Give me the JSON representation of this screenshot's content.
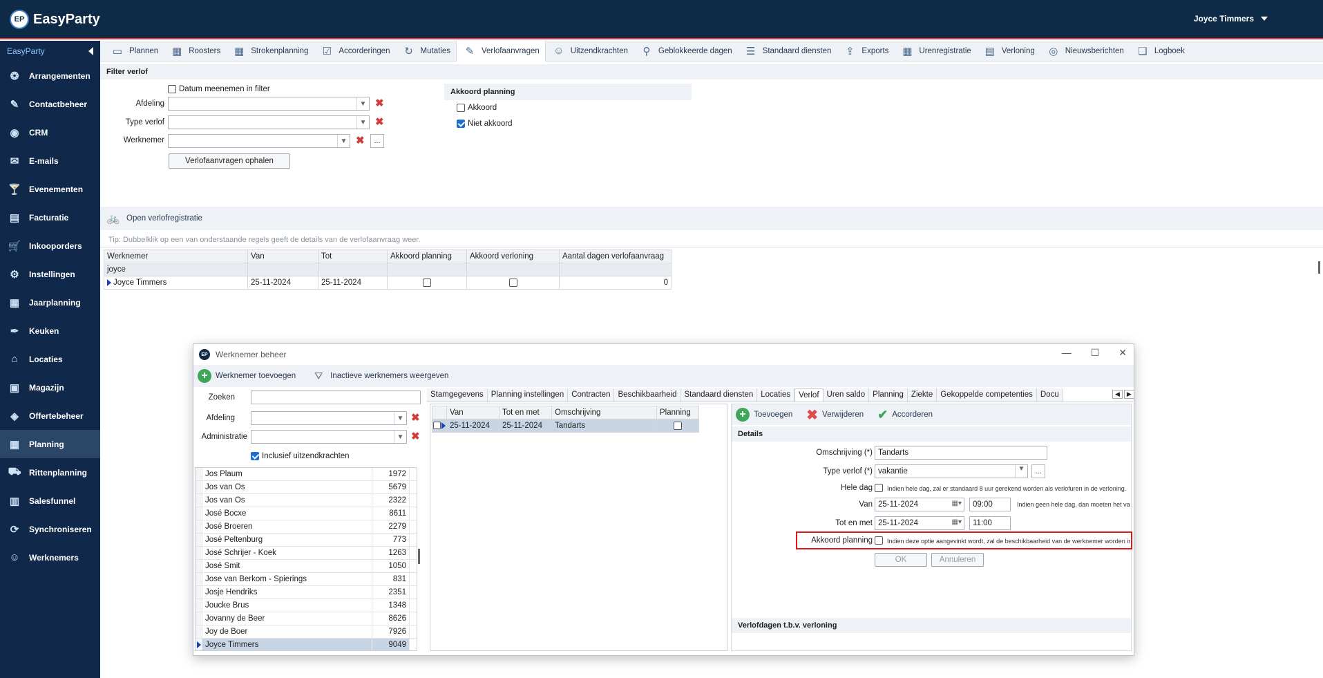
{
  "app": {
    "name": "EasyParty",
    "logo_badge": "EP",
    "user": "Joyce Timmers"
  },
  "sidebar": {
    "header": "EasyParty",
    "items": [
      {
        "label": "Arrangementen",
        "icon": "balloons-icon"
      },
      {
        "label": "Contactbeheer",
        "icon": "contact-edit-icon"
      },
      {
        "label": "CRM",
        "icon": "crm-icon"
      },
      {
        "label": "E-mails",
        "icon": "envelope-icon"
      },
      {
        "label": "Evenementen",
        "icon": "cocktail-icon"
      },
      {
        "label": "Facturatie",
        "icon": "invoice-icon"
      },
      {
        "label": "Inkooporders",
        "icon": "cart-icon"
      },
      {
        "label": "Instellingen",
        "icon": "gear-icon"
      },
      {
        "label": "Jaarplanning",
        "icon": "calendar-icon"
      },
      {
        "label": "Keuken",
        "icon": "knife-icon"
      },
      {
        "label": "Locaties",
        "icon": "house-icon"
      },
      {
        "label": "Magazijn",
        "icon": "box-icon"
      },
      {
        "label": "Offertebeheer",
        "icon": "quote-icon"
      },
      {
        "label": "Planning",
        "icon": "planning-icon"
      },
      {
        "label": "Rittenplanning",
        "icon": "truck-icon"
      },
      {
        "label": "Salesfunnel",
        "icon": "funnel-icon"
      },
      {
        "label": "Synchroniseren",
        "icon": "sync-icon"
      },
      {
        "label": "Werknemers",
        "icon": "employee-icon"
      }
    ],
    "active": "Planning"
  },
  "toolbar": {
    "items": [
      {
        "label": "Plannen",
        "icon": "plan-icon"
      },
      {
        "label": "Roosters",
        "icon": "calendar-icon"
      },
      {
        "label": "Strokenplanning",
        "icon": "calendar-icon"
      },
      {
        "label": "Accorderingen",
        "icon": "approve-icon"
      },
      {
        "label": "Mutaties",
        "icon": "refresh-icon"
      },
      {
        "label": "Verlofaanvragen",
        "icon": "edit-icon"
      },
      {
        "label": "Uitzendkrachten",
        "icon": "people-icon"
      },
      {
        "label": "Geblokkeerde dagen",
        "icon": "search-icon"
      },
      {
        "label": "Standaard diensten",
        "icon": "list-icon"
      },
      {
        "label": "Exports",
        "icon": "upload-icon"
      },
      {
        "label": "Urenregistratie",
        "icon": "calendar-icon"
      },
      {
        "label": "Verloning",
        "icon": "document-check-icon"
      },
      {
        "label": "Nieuwsberichten",
        "icon": "glasses-icon"
      },
      {
        "label": "Logboek",
        "icon": "log-icon"
      }
    ],
    "active": "Verlofaanvragen"
  },
  "filter": {
    "header": "Filter verlof",
    "datum_label": "Datum meenemen in filter",
    "afdeling_label": "Afdeling",
    "type_label": "Type verlof",
    "werknemer_label": "Werknemer",
    "ellipsis": "...",
    "fetch_button": "Verlofaanvragen ophalen",
    "akkoord_header": "Akkoord planning",
    "akkoord_label": "Akkoord",
    "niet_akkoord_label": "Niet akkoord"
  },
  "open_registratie": {
    "title": "Open verlofregistratie",
    "tip": "Tip: Dubbelklik op een van onderstaande regels geeft de details van de verlofaanvraag weer.",
    "columns": [
      "Werknemer",
      "Van",
      "Tot",
      "Akkoord planning",
      "Akkoord verloning",
      "Aantal dagen verlofaanvraag"
    ],
    "filter_value": "joyce",
    "rows": [
      {
        "werknemer": "Joyce Timmers",
        "van": "25-11-2024",
        "tot": "25-11-2024",
        "akkoord_planning": false,
        "akkoord_verloning": false,
        "aantal": "0"
      }
    ]
  },
  "dialog": {
    "title": "Werknemer beheer",
    "logo_badge": "EP",
    "add_employee": "Werknemer toevoegen",
    "show_inactive": "Inactieve werknemers weergeven",
    "zoeken_label": "Zoeken",
    "afdeling_label": "Afdeling",
    "administratie_label": "Administratie",
    "incl_uitzend": "Inclusief uitzendkrachten",
    "employees": [
      {
        "name": "Jos Plaum",
        "num": "1972"
      },
      {
        "name": "Jos van Os",
        "num": "5679"
      },
      {
        "name": "Jos van Os",
        "num": "2322"
      },
      {
        "name": "José Bocxe",
        "num": "8611"
      },
      {
        "name": "José Broeren",
        "num": "2279"
      },
      {
        "name": "José Peltenburg",
        "num": "773"
      },
      {
        "name": "José Schrijer - Koek",
        "num": "1263"
      },
      {
        "name": "José Smit",
        "num": "1050"
      },
      {
        "name": "Jose van Berkom - Spierings",
        "num": "831"
      },
      {
        "name": "Josje Hendriks",
        "num": "2351"
      },
      {
        "name": "Joucke Brus",
        "num": "1348"
      },
      {
        "name": "Jovanny de Beer",
        "num": "8626"
      },
      {
        "name": "Joy de Boer",
        "num": "7926"
      },
      {
        "name": "Joyce Timmers",
        "num": "9049"
      }
    ],
    "selected_employee": "Joyce Timmers",
    "tabs": [
      "Stamgegevens",
      "Planning instellingen",
      "Contracten",
      "Beschikbaarheid",
      "Standaard diensten",
      "Locaties",
      "Verlof",
      "Uren saldo",
      "Planning",
      "Ziekte",
      "Gekoppelde competenties",
      "Docu"
    ],
    "active_tab": "Verlof",
    "verlof_columns": [
      "Van",
      "Tot en met",
      "Omschrijving",
      "Planning"
    ],
    "verlof_rows": [
      {
        "van": "25-11-2024",
        "tot": "25-11-2024",
        "omschrijving": "Tandarts",
        "planning": false
      }
    ],
    "actions": {
      "add": "Toevoegen",
      "delete": "Verwijderen",
      "approve": "Accorderen"
    },
    "details": {
      "header": "Details",
      "omschrijving_label": "Omschrijving (*)",
      "omschrijving_value": "Tandarts",
      "type_label": "Type verlof (*)",
      "type_value": "vakantie",
      "hele_dag_label": "Hele dag",
      "hele_dag_note": "Indien hele dag, zal er standaard 8 uur gerekend worden als verlofuren in de verloning.",
      "van_label": "Van",
      "van_date": "25-11-2024",
      "van_time": "09:00",
      "van_note": "Indien geen hele dag, dan moeten het van",
      "tot_label": "Tot en met",
      "tot_date": "25-11-2024",
      "tot_time": "11:00",
      "akkoord_label": "Akkoord planning",
      "akkoord_note": "Indien deze optie aangevinkt wordt, zal de beschikbaarheid van de werknemer worden in",
      "ok": "OK",
      "cancel": "Annuleren",
      "verlofdagen_header": "Verlofdagen t.b.v. verloning"
    }
  },
  "colors": {
    "nav": "#0e2a47",
    "accent_red": "#e0393e",
    "highlight_box": "#e0161b",
    "selected_row": "#c7d5e4"
  }
}
